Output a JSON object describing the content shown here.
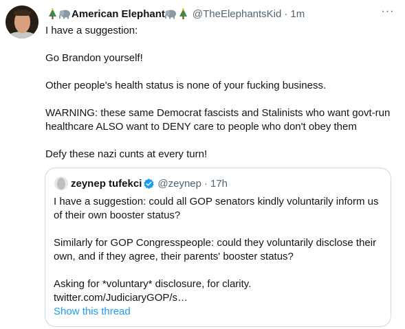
{
  "tweet": {
    "display_name": "American Elephant",
    "handle": "@TheElephantsKid",
    "dot": "·",
    "time": "1m",
    "more_label": "···",
    "lines": [
      "I have a suggestion:",
      "Go Brandon yourself!",
      "Other people's health status is none of your fucking business.",
      "WARNING: these same Democrat fascists and Stalinists who want govt-run",
      "healthcare ALSO want to DENY care to people who don't obey them",
      "Defy these nazi cunts at every turn!"
    ]
  },
  "quote": {
    "display_name": "zeynep tufekci",
    "handle": "@zeynep",
    "dot": "·",
    "time": "17h",
    "lines": [
      "I have a suggestion: could all GOP senators kindly voluntarily inform us",
      "of their own booster status?",
      "Similarly for GOP Congresspeople: could they voluntarily disclose their",
      "own, and if they agree, their parents' booster status?",
      "Asking for *voluntary* disclosure, for clarity.",
      "twitter.com/JudiciaryGOP/s…"
    ],
    "show_thread": "Show this thread"
  },
  "icons": {
    "tree": "christmas-tree-icon",
    "elephant": "elephant-icon",
    "verified": "verified-badge-icon",
    "more": "more-options-icon"
  },
  "colors": {
    "link": "#1d9bf0",
    "secondary_text": "#536471",
    "border": "#cfd9de"
  }
}
